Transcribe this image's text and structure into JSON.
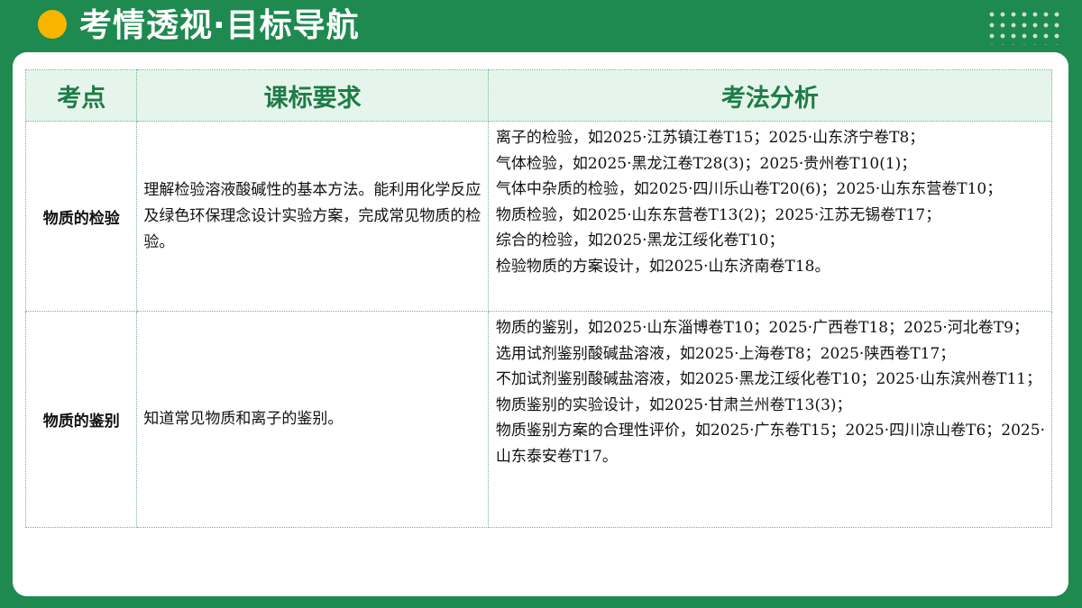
{
  "header": {
    "title": "考情透视·目标导航"
  },
  "colors": {
    "background": "#1e8a50",
    "title_dot": "#f7b500",
    "table_header_bg": "#e6f5ec",
    "table_header_text": "#1e7c46"
  },
  "table": {
    "columns": [
      "考点",
      "课标要求",
      "考法分析"
    ],
    "rows": [
      {
        "point": "物质的检验",
        "requirement": "理解检验溶液酸碱性的基本方法。能利用化学反应及绿色环保理念设计实验方案，完成常见物质的检验。",
        "analysis": [
          "离子的检验，如2025·江苏镇江卷T15；2025·山东济宁卷T8；",
          "气体检验，如2025·黑龙江卷T28(3)；2025·贵州卷T10(1)；",
          "气体中杂质的检验，如2025·四川乐山卷T20(6)；2025·山东东营卷T10；",
          "物质检验，如2025·山东东营卷T13(2)；2025·江苏无锡卷T17；",
          "综合的检验，如2025·黑龙江绥化卷T10；",
          "检验物质的方案设计，如2025·山东济南卷T18。"
        ]
      },
      {
        "point": "物质的鉴别",
        "requirement": "知道常见物质和离子的鉴别。",
        "analysis": [
          "物质的鉴别，如2025·山东淄博卷T10；2025·广西卷T18；2025·河北卷T9；",
          "选用试剂鉴别酸碱盐溶液，如2025·上海卷T8；2025·陕西卷T17；",
          "不加试剂鉴别酸碱盐溶液，如2025·黑龙江绥化卷T10；2025·山东滨州卷T11；",
          "物质鉴别的实验设计，如2025·甘肃兰州卷T13(3)；",
          "物质鉴别方案的合理性评价，如2025·广东卷T15；2025·四川凉山卷T6；2025·山东泰安卷T17。"
        ]
      }
    ]
  }
}
